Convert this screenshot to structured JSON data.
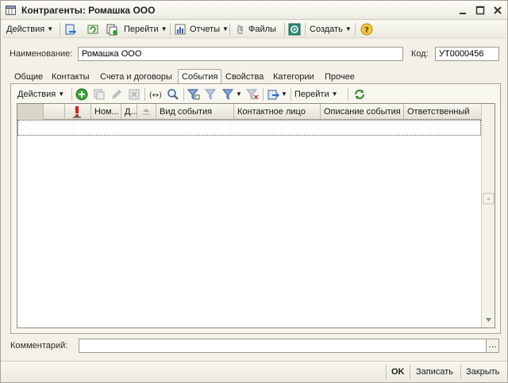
{
  "window": {
    "title": "Контрагенты: Ромашка ООО"
  },
  "toolbar": {
    "actions_label": "Действия",
    "goto_label": "Перейти",
    "reports_label": "Отчеты",
    "files_label": "Файлы",
    "create_label": "Создать"
  },
  "form": {
    "name_label": "Наименование:",
    "name_value": "Ромашка ООО",
    "code_label": "Код:",
    "code_value": "УТ0000456",
    "comment_label": "Комментарий:",
    "comment_value": ""
  },
  "tabs": [
    {
      "label": "Общие"
    },
    {
      "label": "Контакты"
    },
    {
      "label": "Счета и договоры"
    },
    {
      "label": "События"
    },
    {
      "label": "Свойства"
    },
    {
      "label": "Категории"
    },
    {
      "label": "Прочее"
    }
  ],
  "active_tab": "События",
  "subtoolbar": {
    "actions_label": "Действия",
    "goto_label": "Перейти"
  },
  "grid": {
    "columns": [
      "Ном...",
      "Д...",
      "Вид события",
      "Контактное лицо",
      "Описание события",
      "Ответственный"
    ],
    "rows": []
  },
  "bottom": {
    "ok_label": "OK",
    "save_label": "Записать",
    "close_label": "Закрыть"
  }
}
